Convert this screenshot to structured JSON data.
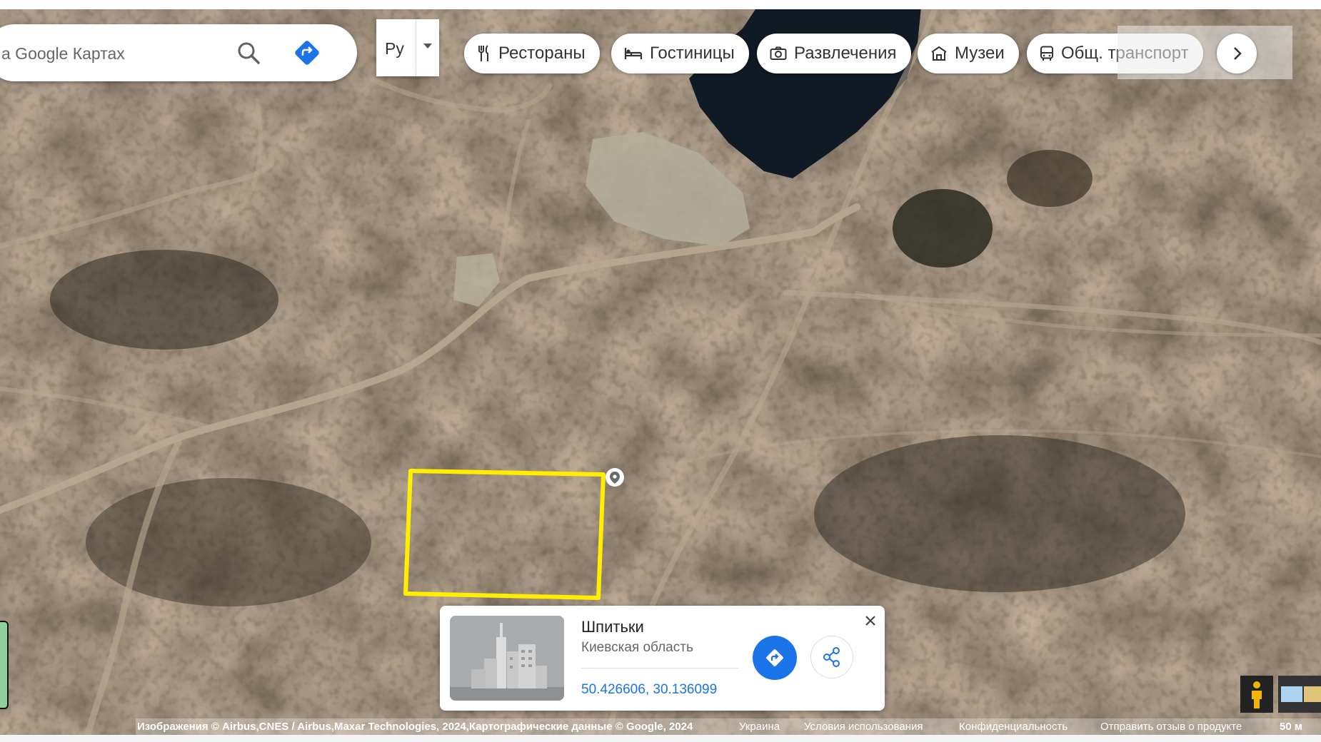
{
  "search": {
    "placeholder": "а Google Картах"
  },
  "language_button": {
    "label": "Ру"
  },
  "category_chips": [
    {
      "label": "Рестораны",
      "icon": "fork-knife-icon"
    },
    {
      "label": "Гостиницы",
      "icon": "bed-icon"
    },
    {
      "label": "Развлечения",
      "icon": "camera-icon"
    },
    {
      "label": "Музеи",
      "icon": "museum-icon"
    },
    {
      "label": "Общ. транспорт",
      "icon": "bus-icon"
    }
  ],
  "place_card": {
    "title": "Шпитьки",
    "subtitle": "Киевская область",
    "coordinates": "50.426606, 30.136099"
  },
  "footer": {
    "attribution": "Изображения © Airbus,CNES / Airbus,Maxar Technologies, 2024,Картографические данные © Google, 2024",
    "country": "Украина",
    "terms": "Условия использования",
    "privacy": "Конфиденциальность",
    "feedback": "Отправить отзыв о продукте",
    "scale": "50 м"
  },
  "colors": {
    "highlight": "#ffee00",
    "accent_blue": "#1a73e8"
  }
}
